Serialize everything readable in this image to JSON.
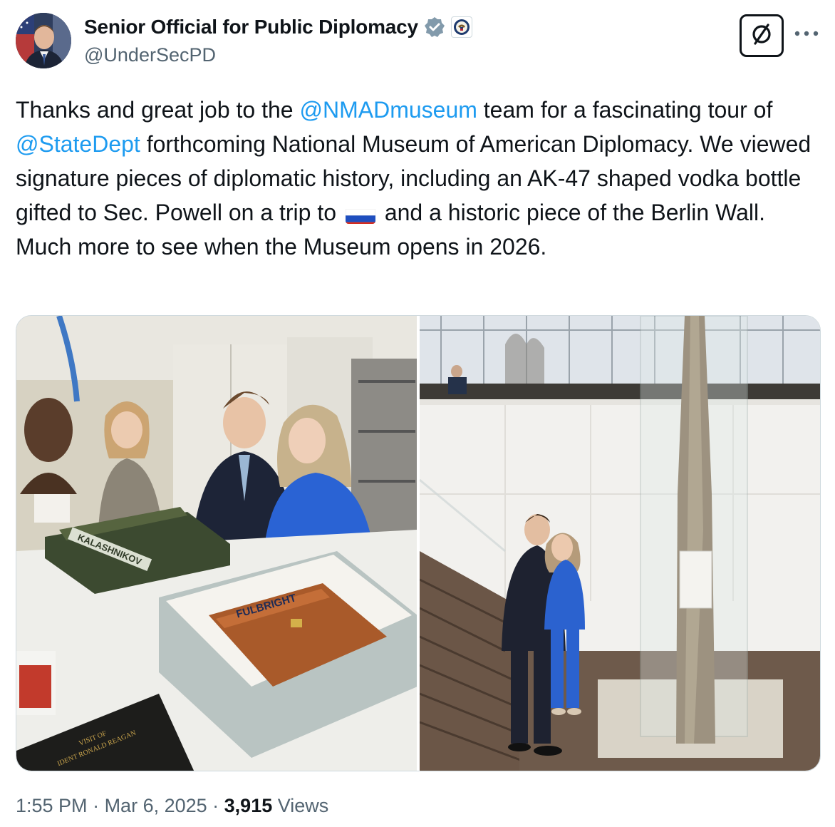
{
  "author": {
    "display_name": "Senior Official for Public Diplomacy",
    "handle": "@UnderSecPD",
    "avatar_icon": "profile-photo-avatar",
    "verified_icon": "verified-badge-icon",
    "affiliation_icon": "department-of-state-seal-icon"
  },
  "actions": {
    "grok_icon": "grok-icon",
    "more_icon": "more-options-icon"
  },
  "tweet": {
    "t1": "Thanks and great job to the ",
    "m1": "@NMADmuseum",
    "t2": " team for a fascinating tour of ",
    "m2": "@StateDept",
    "t3": " forthcoming National Museum of American Diplomacy. We viewed signature pieces of diplomatic history, including an AK-47 shaped vodka bottle gifted to Sec. Powell on a trip to ",
    "flag": "russia-flag-emoji",
    "t4": " and a historic piece of the Berlin Wall. Much more to see when the Museum opens in 2026."
  },
  "photos": {
    "left": {
      "box_lid_text": "KALASHNIKOV",
      "case_text": "FULBRIGHT",
      "folder_line1": "VISIT OF",
      "folder_line2": "IDENT RONALD REAGAN"
    }
  },
  "meta": {
    "time": "1:55 PM",
    "sep1": " · ",
    "date": "Mar 6, 2025",
    "sep2": " · ",
    "views_count": "3,915",
    "views_label": " Views"
  },
  "colors": {
    "link": "#1d9bf0",
    "secondary_text": "#536471",
    "primary_text": "#0f1419"
  }
}
